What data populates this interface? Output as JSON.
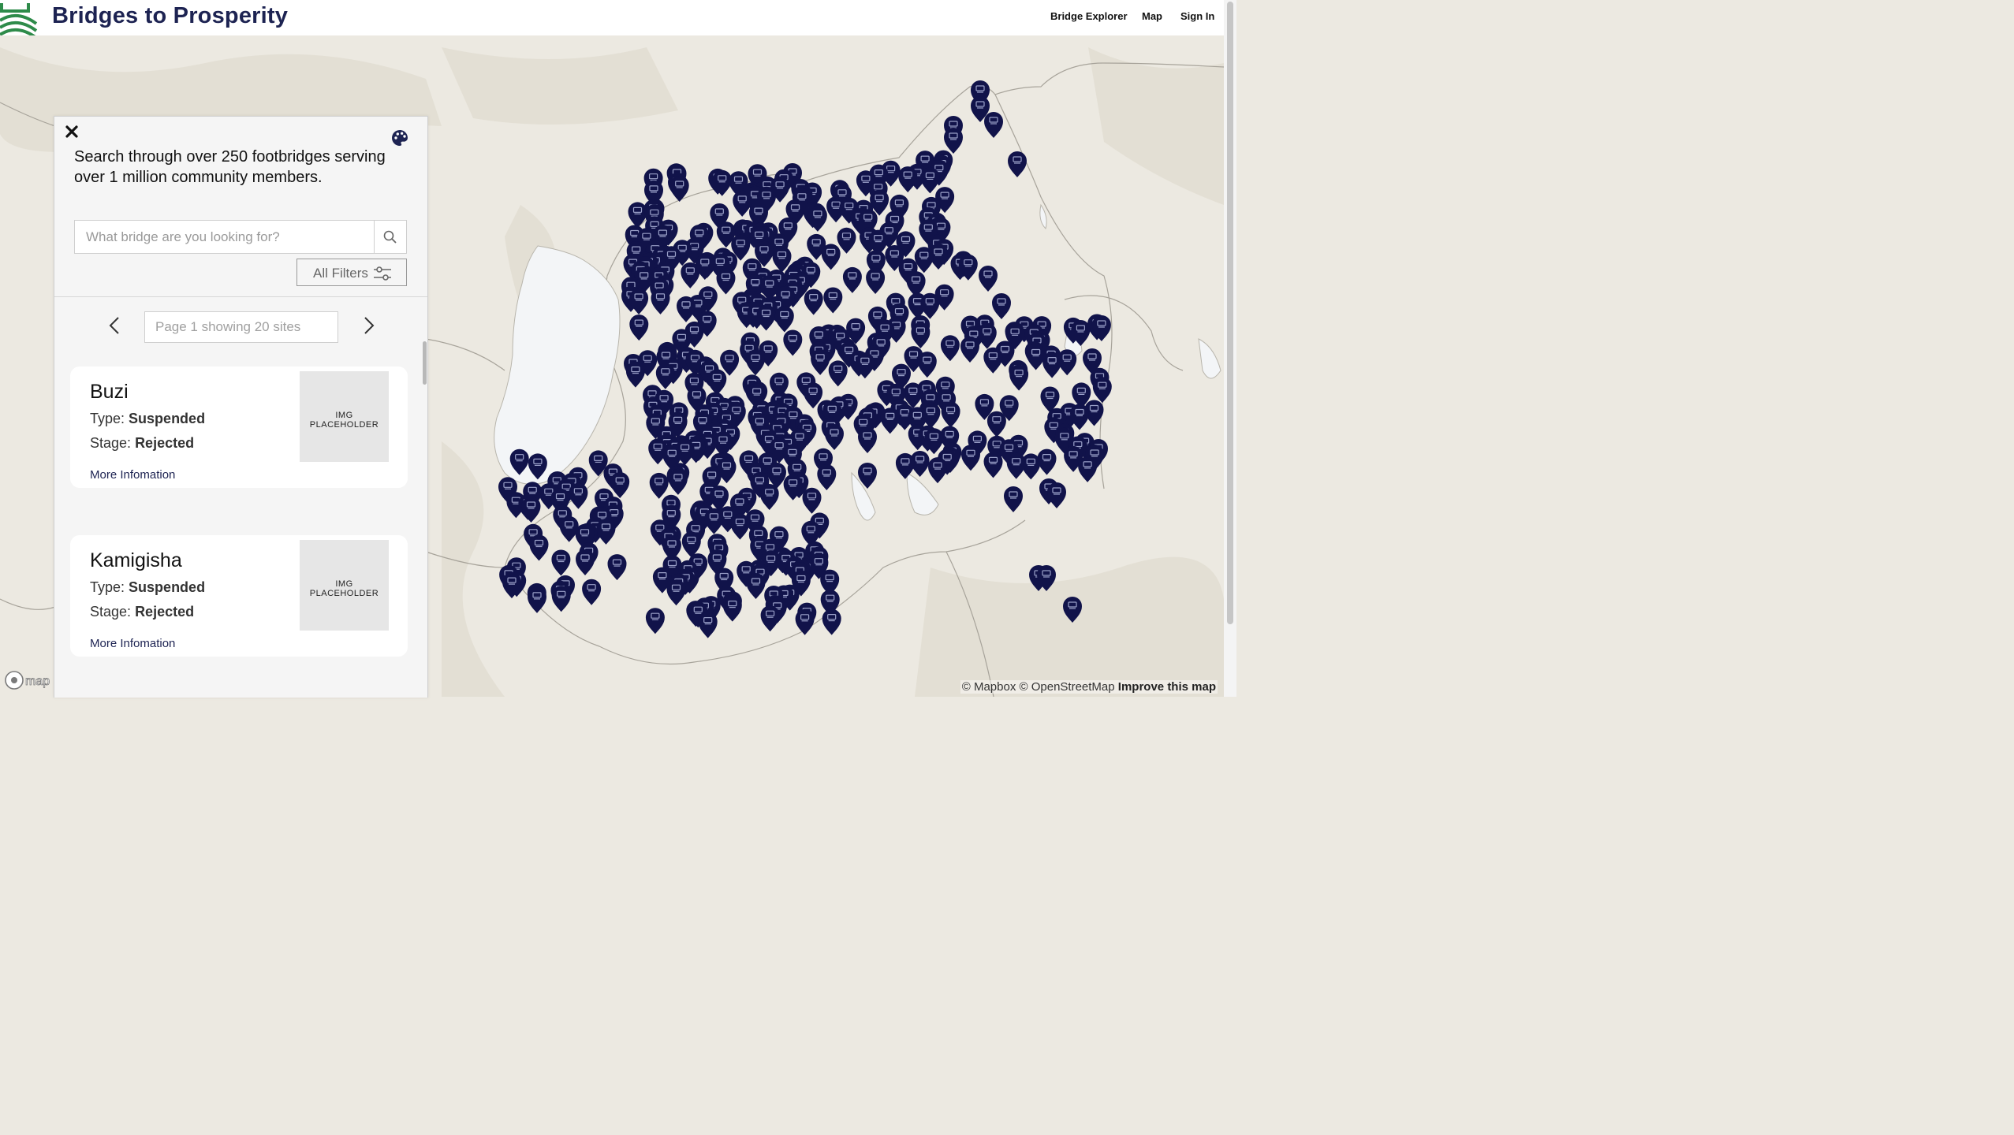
{
  "header": {
    "brand": "Bridges to Prosperity",
    "nav": [
      "Bridge Explorer",
      "Map",
      "Sign In"
    ]
  },
  "panel": {
    "intro": "Search through over 250 footbridges serving over 1 million community members.",
    "search_placeholder": "What bridge are you looking for?",
    "filters_label": "All Filters",
    "page_placeholder": "Page 1 showing 20 sites",
    "cards": [
      {
        "name": "Buzi",
        "type_label": "Type:",
        "type": "Suspended",
        "stage_label": "Stage:",
        "stage": "Rejected",
        "link": "More Infomation",
        "image_label": "IMG PLACEHOLDER"
      },
      {
        "name": "Kamigisha",
        "type_label": "Type:",
        "type": "Suspended",
        "stage_label": "Stage:",
        "stage": "Rejected",
        "link": "More Infomation",
        "image_label": "IMG PLACEHOLDER"
      }
    ]
  },
  "map": {
    "attribution": "© Mapbox © OpenStreetMap",
    "improve_label": "Improve this map",
    "marker_color": "#11134a",
    "land_color": "#ece9e1",
    "lake_color": "#f3f5f7"
  }
}
